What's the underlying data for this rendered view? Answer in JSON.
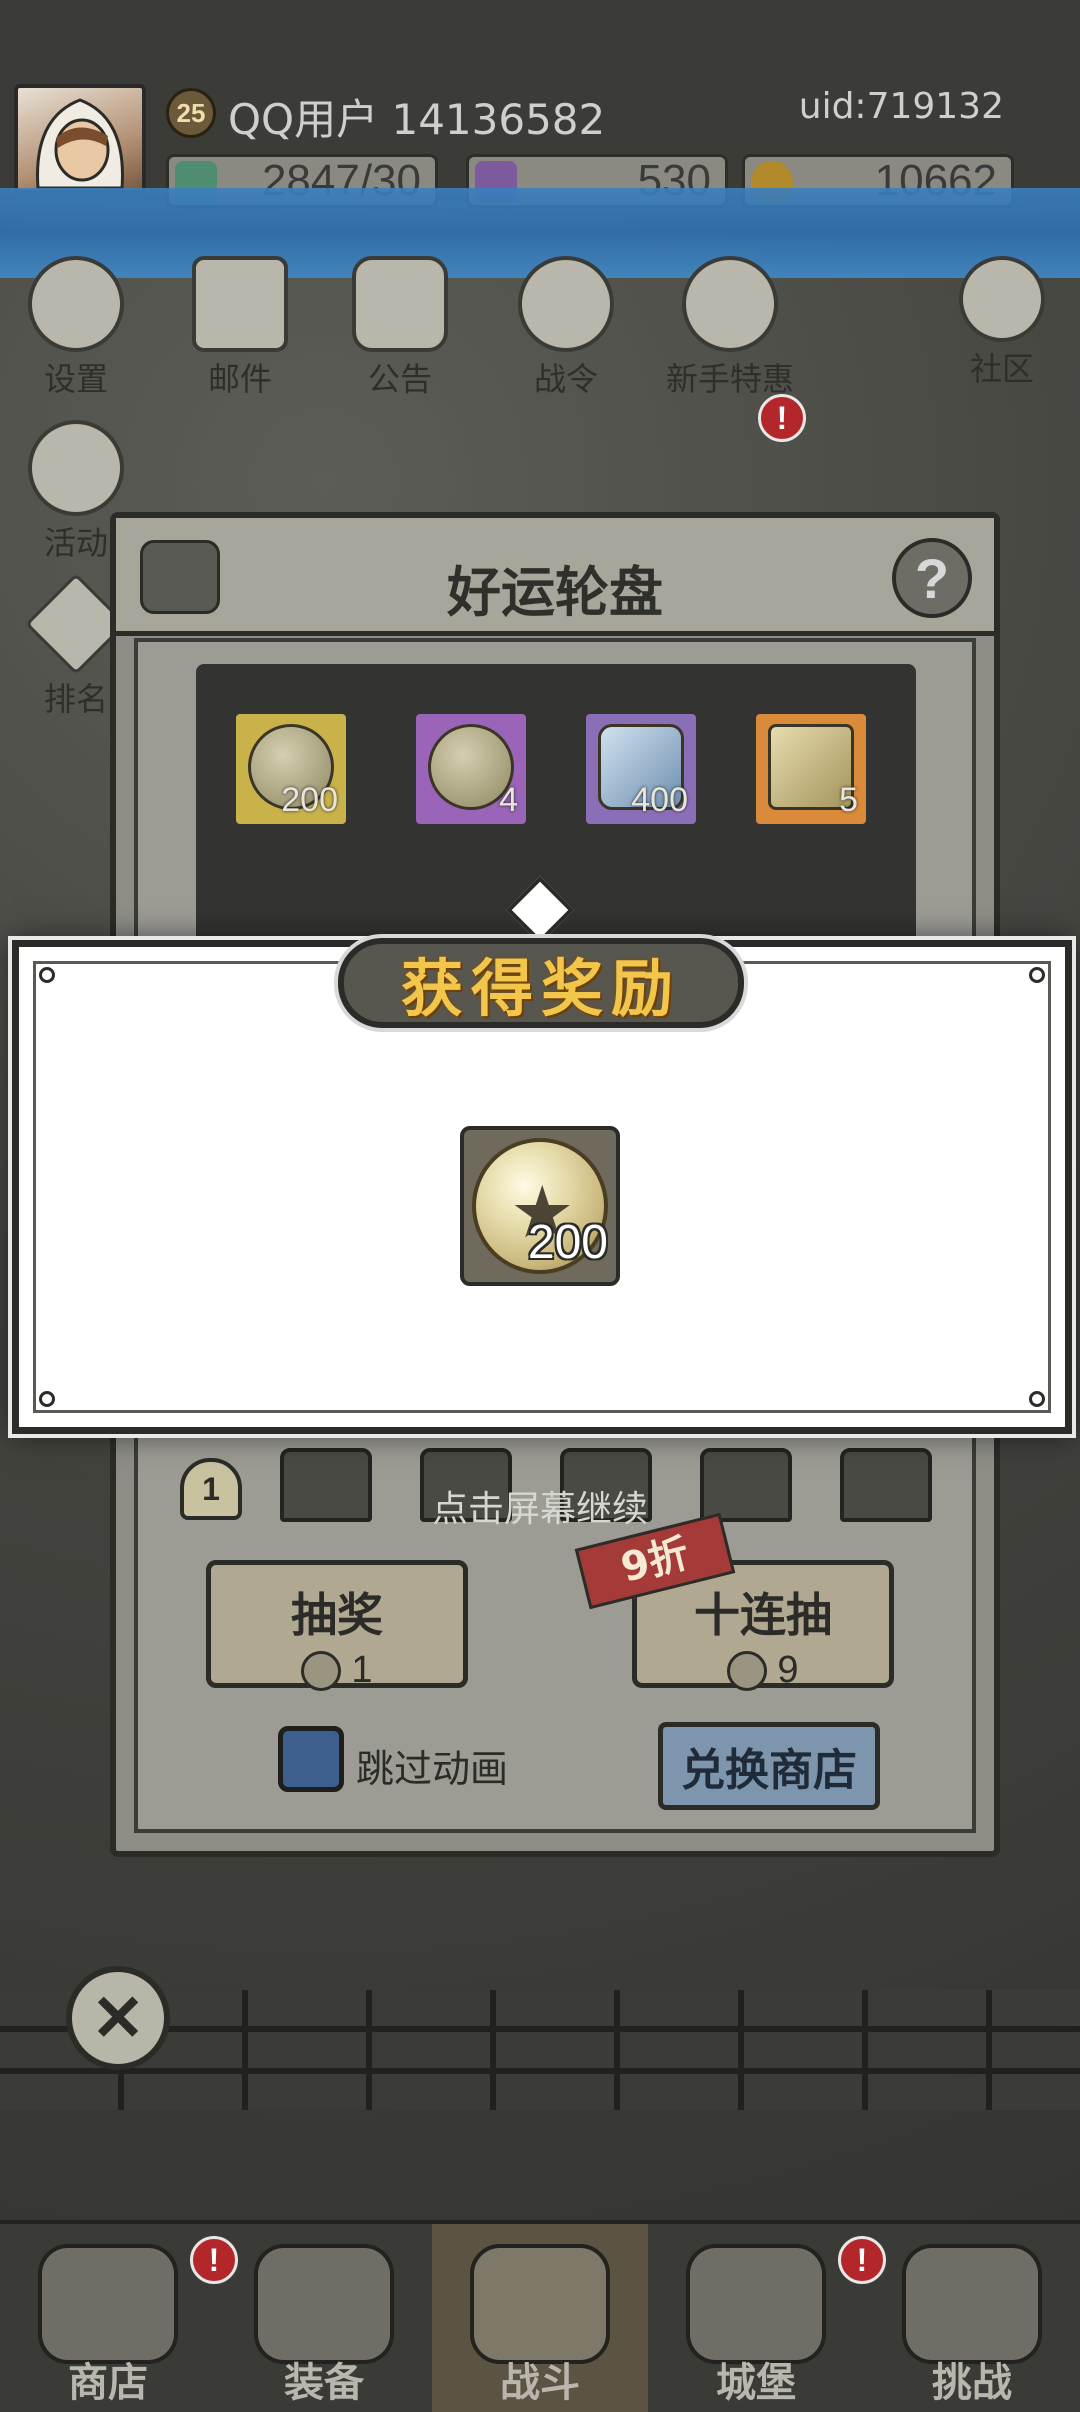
{
  "header": {
    "level": "25",
    "username": "QQ用户 14136582",
    "uid": "uid:719132",
    "resources": [
      {
        "icon": "gem-icon",
        "value": "2847/30"
      },
      {
        "icon": "crystal-icon",
        "value": "530"
      },
      {
        "icon": "gold-icon",
        "value": "10662"
      }
    ]
  },
  "top_menu": [
    {
      "label": "设置",
      "icon": "gear-icon"
    },
    {
      "label": "邮件",
      "icon": "mail-icon"
    },
    {
      "label": "公告",
      "icon": "scroll-icon"
    },
    {
      "label": "战令",
      "icon": "battle-pass-icon"
    },
    {
      "label": "新手特惠",
      "icon": "gift-bag-icon"
    },
    {
      "label": "社区",
      "icon": "home-icon"
    }
  ],
  "side_menu": [
    {
      "label": "活动",
      "icon": "wreath-icon"
    },
    {
      "label": "排名",
      "icon": "rank-icon"
    }
  ],
  "second_row_badge": "!",
  "lottery": {
    "title": "好运轮盘",
    "help": "?",
    "prizes": [
      {
        "count": "200",
        "color": "#c9b24a",
        "type": "coin"
      },
      {
        "count": "4",
        "color": "#9a64b8",
        "type": "coin"
      },
      {
        "count": "400",
        "color": "#8a6fb6",
        "type": "crystal"
      },
      {
        "count": "5",
        "color": "#d98a3a",
        "type": "key"
      }
    ],
    "progress_step": "1",
    "tap_hint": "点击屏幕继续",
    "draw_button": "抽奖",
    "draw_cost": "1",
    "ten_draw_button": "十连抽",
    "ten_draw_cost": "9",
    "discount": "9折",
    "skip_animation": "跳过动画",
    "exchange_shop": "兑换商店"
  },
  "reward_modal": {
    "title": "获得奖励",
    "item_icon": "star-coin-icon",
    "item_count": "200"
  },
  "close_symbol": "✕",
  "bottom_nav": [
    {
      "label": "商店",
      "badge": "!"
    },
    {
      "label": "装备",
      "badge": ""
    },
    {
      "label": "战斗",
      "badge": "",
      "active": true
    },
    {
      "label": "城堡",
      "badge": "!"
    },
    {
      "label": "挑战",
      "badge": ""
    }
  ]
}
